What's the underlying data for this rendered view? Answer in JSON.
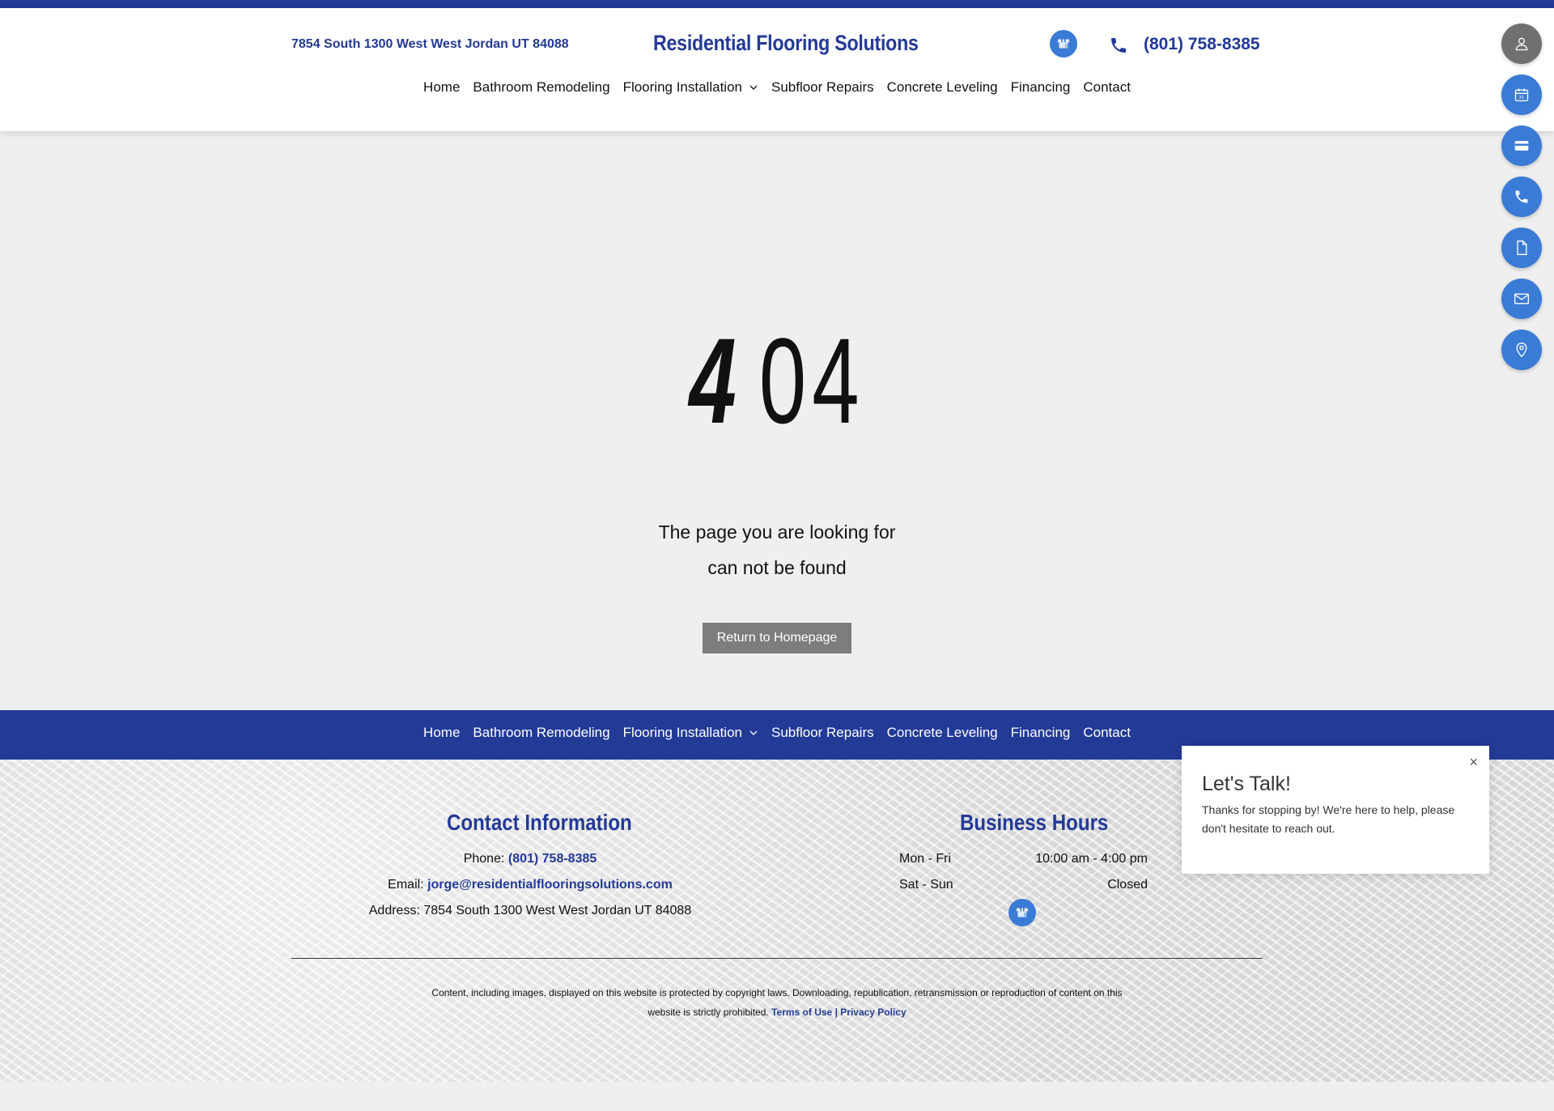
{
  "header": {
    "address": "7854 South 1300 West West Jordan UT 84088",
    "brand": "Residential Flooring Solutions",
    "phone": "(801) 758-8385",
    "gbiz_icon": "google-business-icon",
    "phone_icon": "phone-icon"
  },
  "nav": {
    "items": [
      "Home",
      "Bathroom Remodeling",
      "Flooring Installation",
      "Subfloor Repairs",
      "Concrete Leveling",
      "Financing",
      "Contact"
    ]
  },
  "error": {
    "code_first": "4",
    "code_rest": "04",
    "line1": "The page you are looking for",
    "line2": "can not be found",
    "button": "Return to Homepage"
  },
  "footer": {
    "contact_title": "Contact Information",
    "phone_label": "Phone: ",
    "phone": "(801) 758-8385",
    "email_label": "Email: ",
    "email": "jorge@residentialflooringsolutions.com",
    "address_label": "Address: ",
    "address": "7854 South 1300 West West Jordan UT 84088",
    "hours_title": "Business Hours",
    "hours": [
      {
        "days": "Mon - Fri",
        "time": "10:00 am - 4:00 pm"
      },
      {
        "days": "Sat - Sun",
        "time": "Closed"
      }
    ],
    "legal_text": "Content, including images, displayed on this website is protected by copyright laws. Downloading, republication, retransmission or reproduction of content on this website is strictly prohibited.",
    "terms": "Terms of Use",
    "separator": "|",
    "privacy": "Privacy Policy"
  },
  "sidebar": {
    "icons": [
      "user-icon",
      "calendar-icon",
      "credit-card-icon",
      "phone-icon",
      "document-icon",
      "mail-icon",
      "location-pin-icon"
    ]
  },
  "popup": {
    "close": "×",
    "title": "Let's Talk!",
    "text": "Thanks for stopping by! We're here to help, please don't hesitate to reach out."
  },
  "colors": {
    "brand_blue": "#233a97",
    "accent_blue": "#3a7bd5",
    "button_gray": "#7d7d7d"
  }
}
